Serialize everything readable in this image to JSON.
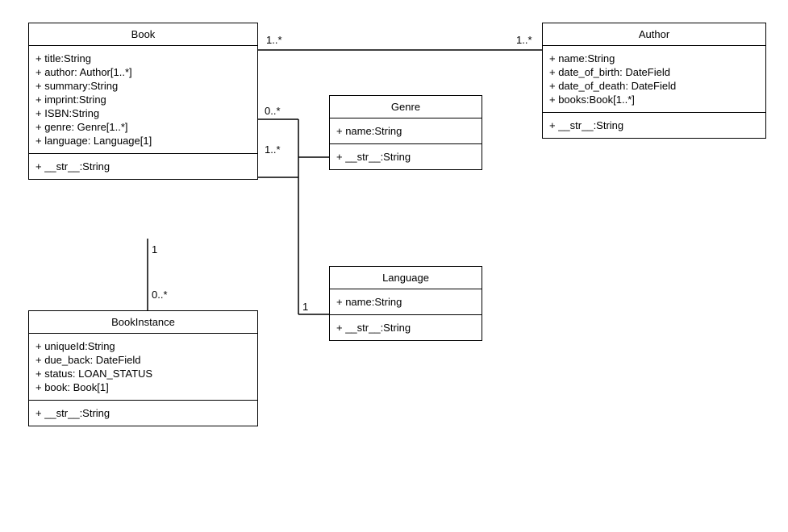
{
  "classes": {
    "book": {
      "title": "Book",
      "attributes": [
        "+ title:String",
        "+ author: Author[1..*]",
        "+ summary:String",
        "+ imprint:String",
        "+ ISBN:String",
        "+ genre: Genre[1..*]",
        "+ language: Language[1]"
      ],
      "methods": [
        "+ __str__:String"
      ]
    },
    "author": {
      "title": "Author",
      "attributes": [
        "+ name:String",
        "+ date_of_birth: DateField",
        "+ date_of_death: DateField",
        "+ books:Book[1..*]"
      ],
      "methods": [
        "+ __str__:String"
      ]
    },
    "genre": {
      "title": "Genre",
      "attributes": [
        "+ name:String"
      ],
      "methods": [
        "+ __str__:String"
      ]
    },
    "language": {
      "title": "Language",
      "attributes": [
        "+ name:String"
      ],
      "methods": [
        "+ __str__:String"
      ]
    },
    "bookinstance": {
      "title": "BookInstance",
      "attributes": [
        "+ uniqueId:String",
        "+ due_back: DateField",
        "+ status: LOAN_STATUS",
        "+ book: Book[1]"
      ],
      "methods": [
        "+ __str__:String"
      ]
    }
  },
  "relationships": {
    "book_author_label_left": "1..*",
    "book_author_label_right": "1..*",
    "book_genre_label_left": "0..*",
    "book_genre_label_right": "1..*",
    "book_language_label_right": "1",
    "book_bookinstance_label_top": "1",
    "book_bookinstance_label_bottom": "0..*"
  }
}
